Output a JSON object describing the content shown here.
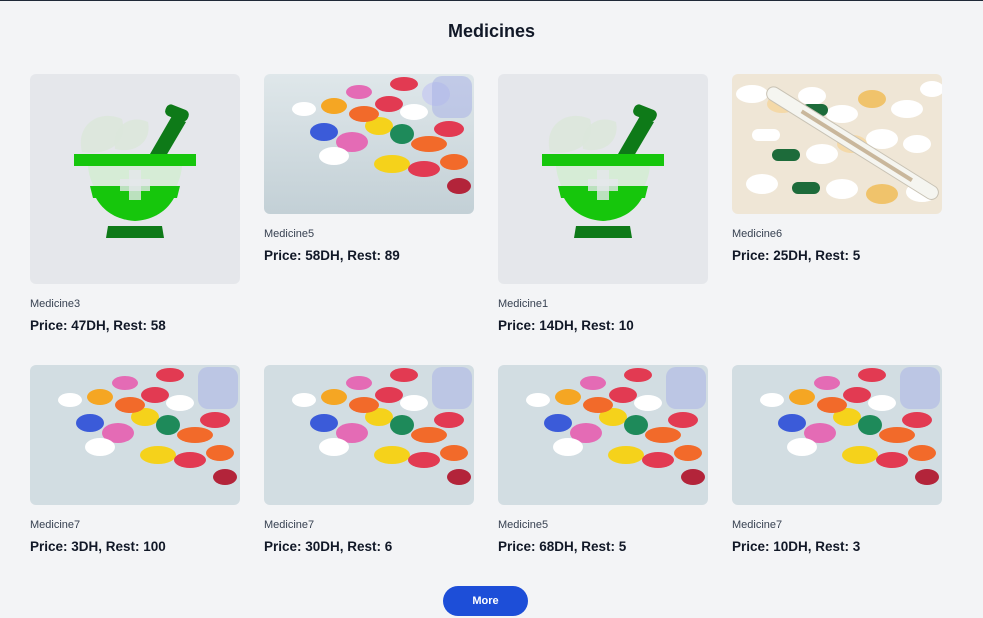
{
  "page_title": "Medicines",
  "more_button": "More",
  "cards": [
    {
      "name": "Medicine3",
      "price_text": "Price: 47DH, Rest: 58",
      "image": "mortar-pestle-icon"
    },
    {
      "name": "Medicine5",
      "price_text": "Price: 58DH, Rest: 89",
      "image": "pills-photo"
    },
    {
      "name": "Medicine1",
      "price_text": "Price: 14DH, Rest: 10",
      "image": "mortar-pestle-icon"
    },
    {
      "name": "Medicine6",
      "price_text": "Price: 25DH, Rest: 5",
      "image": "tablets-thermometer-photo"
    },
    {
      "name": "Medicine7",
      "price_text": "Price: 3DH, Rest: 100",
      "image": "pills-photo"
    },
    {
      "name": "Medicine7",
      "price_text": "Price: 30DH, Rest: 6",
      "image": "pills-photo"
    },
    {
      "name": "Medicine5",
      "price_text": "Price: 68DH, Rest: 5",
      "image": "pills-photo"
    },
    {
      "name": "Medicine7",
      "price_text": "Price: 10DH, Rest: 3",
      "image": "pills-photo"
    }
  ],
  "colors": {
    "accent": "#1d4ed8",
    "mortar_green": "#16c60c",
    "mortar_dark": "#0e7a18"
  }
}
